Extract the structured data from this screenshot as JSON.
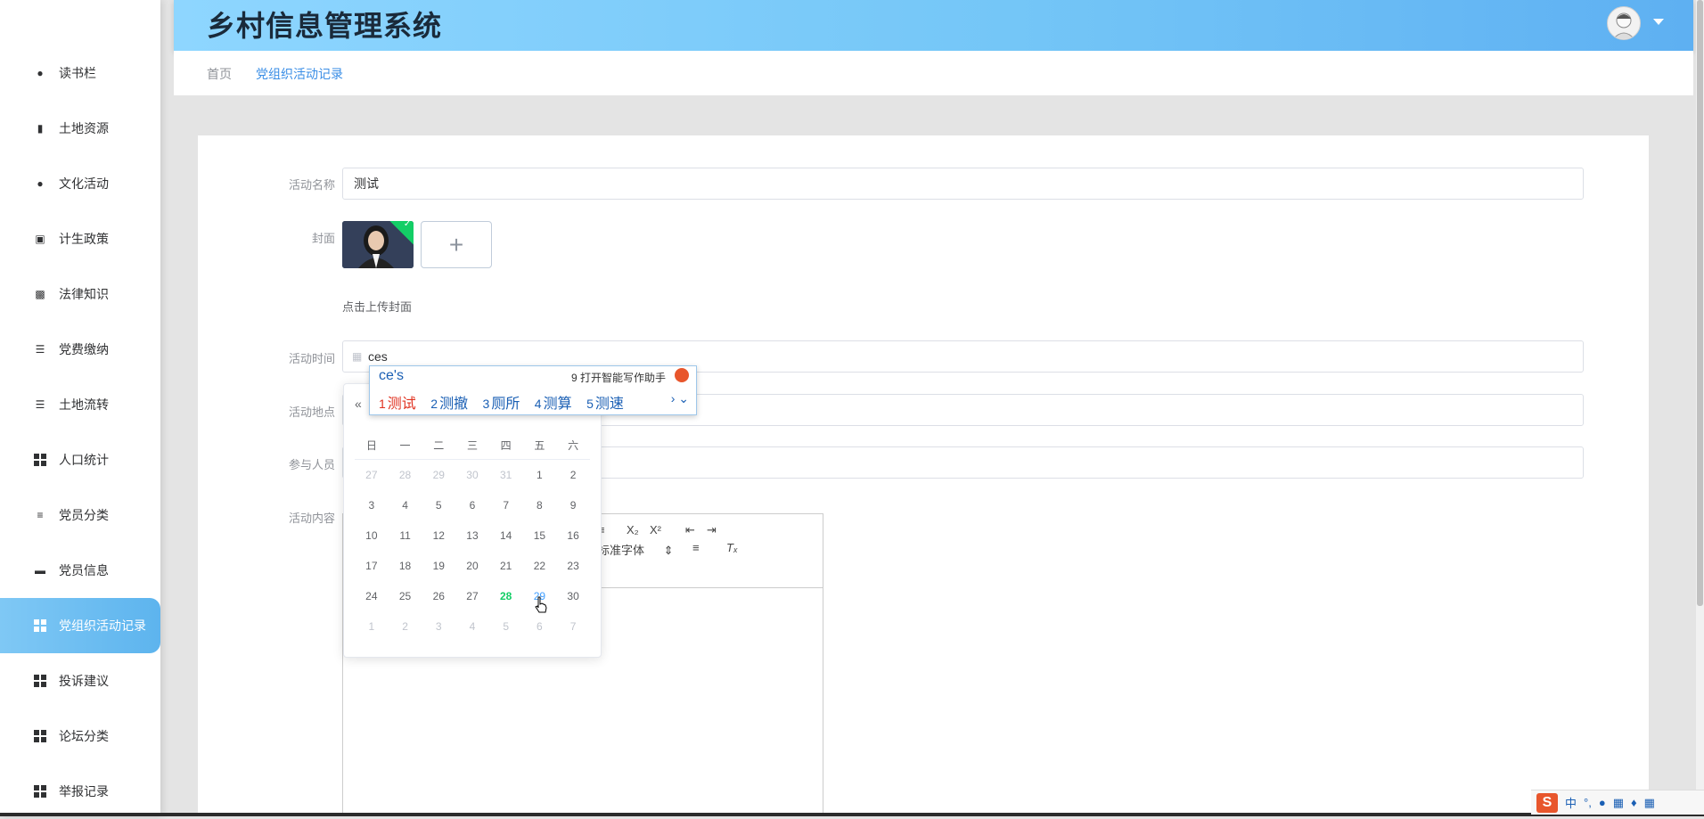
{
  "header": {
    "title": "乡村信息管理系统"
  },
  "sidebar": {
    "items": [
      {
        "label": "读书栏",
        "icon": "user-icon"
      },
      {
        "label": "土地资源",
        "icon": "clipboard-icon"
      },
      {
        "label": "文化活动",
        "icon": "location-pin-icon"
      },
      {
        "label": "计生政策",
        "icon": "chart-icon"
      },
      {
        "label": "法律知识",
        "icon": "briefcase-icon"
      },
      {
        "label": "党费缴纳",
        "icon": "list-icon"
      },
      {
        "label": "土地流转",
        "icon": "list-icon"
      },
      {
        "label": "人口统计",
        "icon": "grid-icon"
      },
      {
        "label": "党员分类",
        "icon": "sliders-icon"
      },
      {
        "label": "党员信息",
        "icon": "wallet-icon"
      },
      {
        "label": "党组织活动记录",
        "icon": "grid-icon",
        "active": true
      },
      {
        "label": "投诉建议",
        "icon": "grid-icon"
      },
      {
        "label": "论坛分类",
        "icon": "grid-icon"
      },
      {
        "label": "举报记录",
        "icon": "grid-icon"
      }
    ]
  },
  "breadcrumb": {
    "home": "首页",
    "current": "党组织活动记录"
  },
  "form": {
    "name_label": "活动名称",
    "name_value": "测试",
    "cover_label": "封面",
    "upload_hint": "点击上传封面",
    "time_label": "活动时间",
    "time_value": "ces",
    "place_label": "活动地点",
    "participants_label": "参与人员",
    "content_label": "活动内容"
  },
  "editor": {
    "font_label": "标准字体"
  },
  "datepicker": {
    "weekdays": [
      "日",
      "一",
      "二",
      "三",
      "四",
      "五",
      "六"
    ],
    "weeks": [
      [
        27,
        28,
        29,
        30,
        31,
        1,
        2
      ],
      [
        3,
        4,
        5,
        6,
        7,
        8,
        9
      ],
      [
        10,
        11,
        12,
        13,
        14,
        15,
        16
      ],
      [
        17,
        18,
        19,
        20,
        21,
        22,
        23
      ],
      [
        24,
        25,
        26,
        27,
        28,
        29,
        30
      ],
      [
        1,
        2,
        3,
        4,
        5,
        6,
        7
      ]
    ],
    "today": 28
  },
  "ime": {
    "composition": "ce's",
    "assistant": "9 打开智能写作助手",
    "candidates": [
      "测试",
      "测撤",
      "厕所",
      "测算",
      "测速"
    ]
  },
  "tray": {
    "lang": "中"
  },
  "colors": {
    "accent": "#409eff",
    "today": "#13ce66",
    "header_start": "#8ed6ff",
    "header_end": "#5eb0f2"
  }
}
